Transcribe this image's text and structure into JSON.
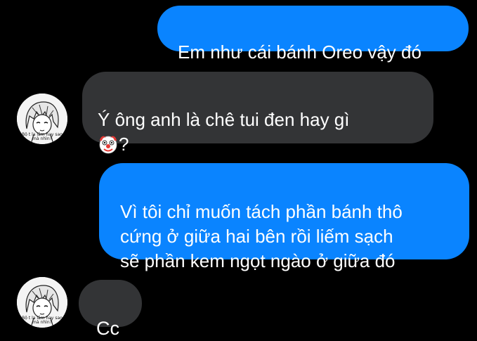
{
  "conversation": {
    "messages": [
      {
        "sender": "me",
        "text": "Em như cái bánh Oreo vậy đó"
      },
      {
        "sender": "them",
        "text": "Ý ông anh là chê tui đen hay gì",
        "suffix": "?",
        "emoji": "clown-face-icon"
      },
      {
        "sender": "me",
        "text": "Vì tôi chỉ muốn tách phần bánh thô\ncứng ở giữa hai bên rồi liếm sạch\nsẽ phần kem ngọt ngào ở giữa đó"
      },
      {
        "sender": "them",
        "text": "Cc"
      }
    ],
    "avatar_caption": "Bộ t lạ lắm hay sao\nmà nhìn?"
  },
  "colors": {
    "background": "#000000",
    "outgoing_bubble": "#0a84ff",
    "incoming_bubble": "#333436",
    "text": "#ffffff"
  }
}
